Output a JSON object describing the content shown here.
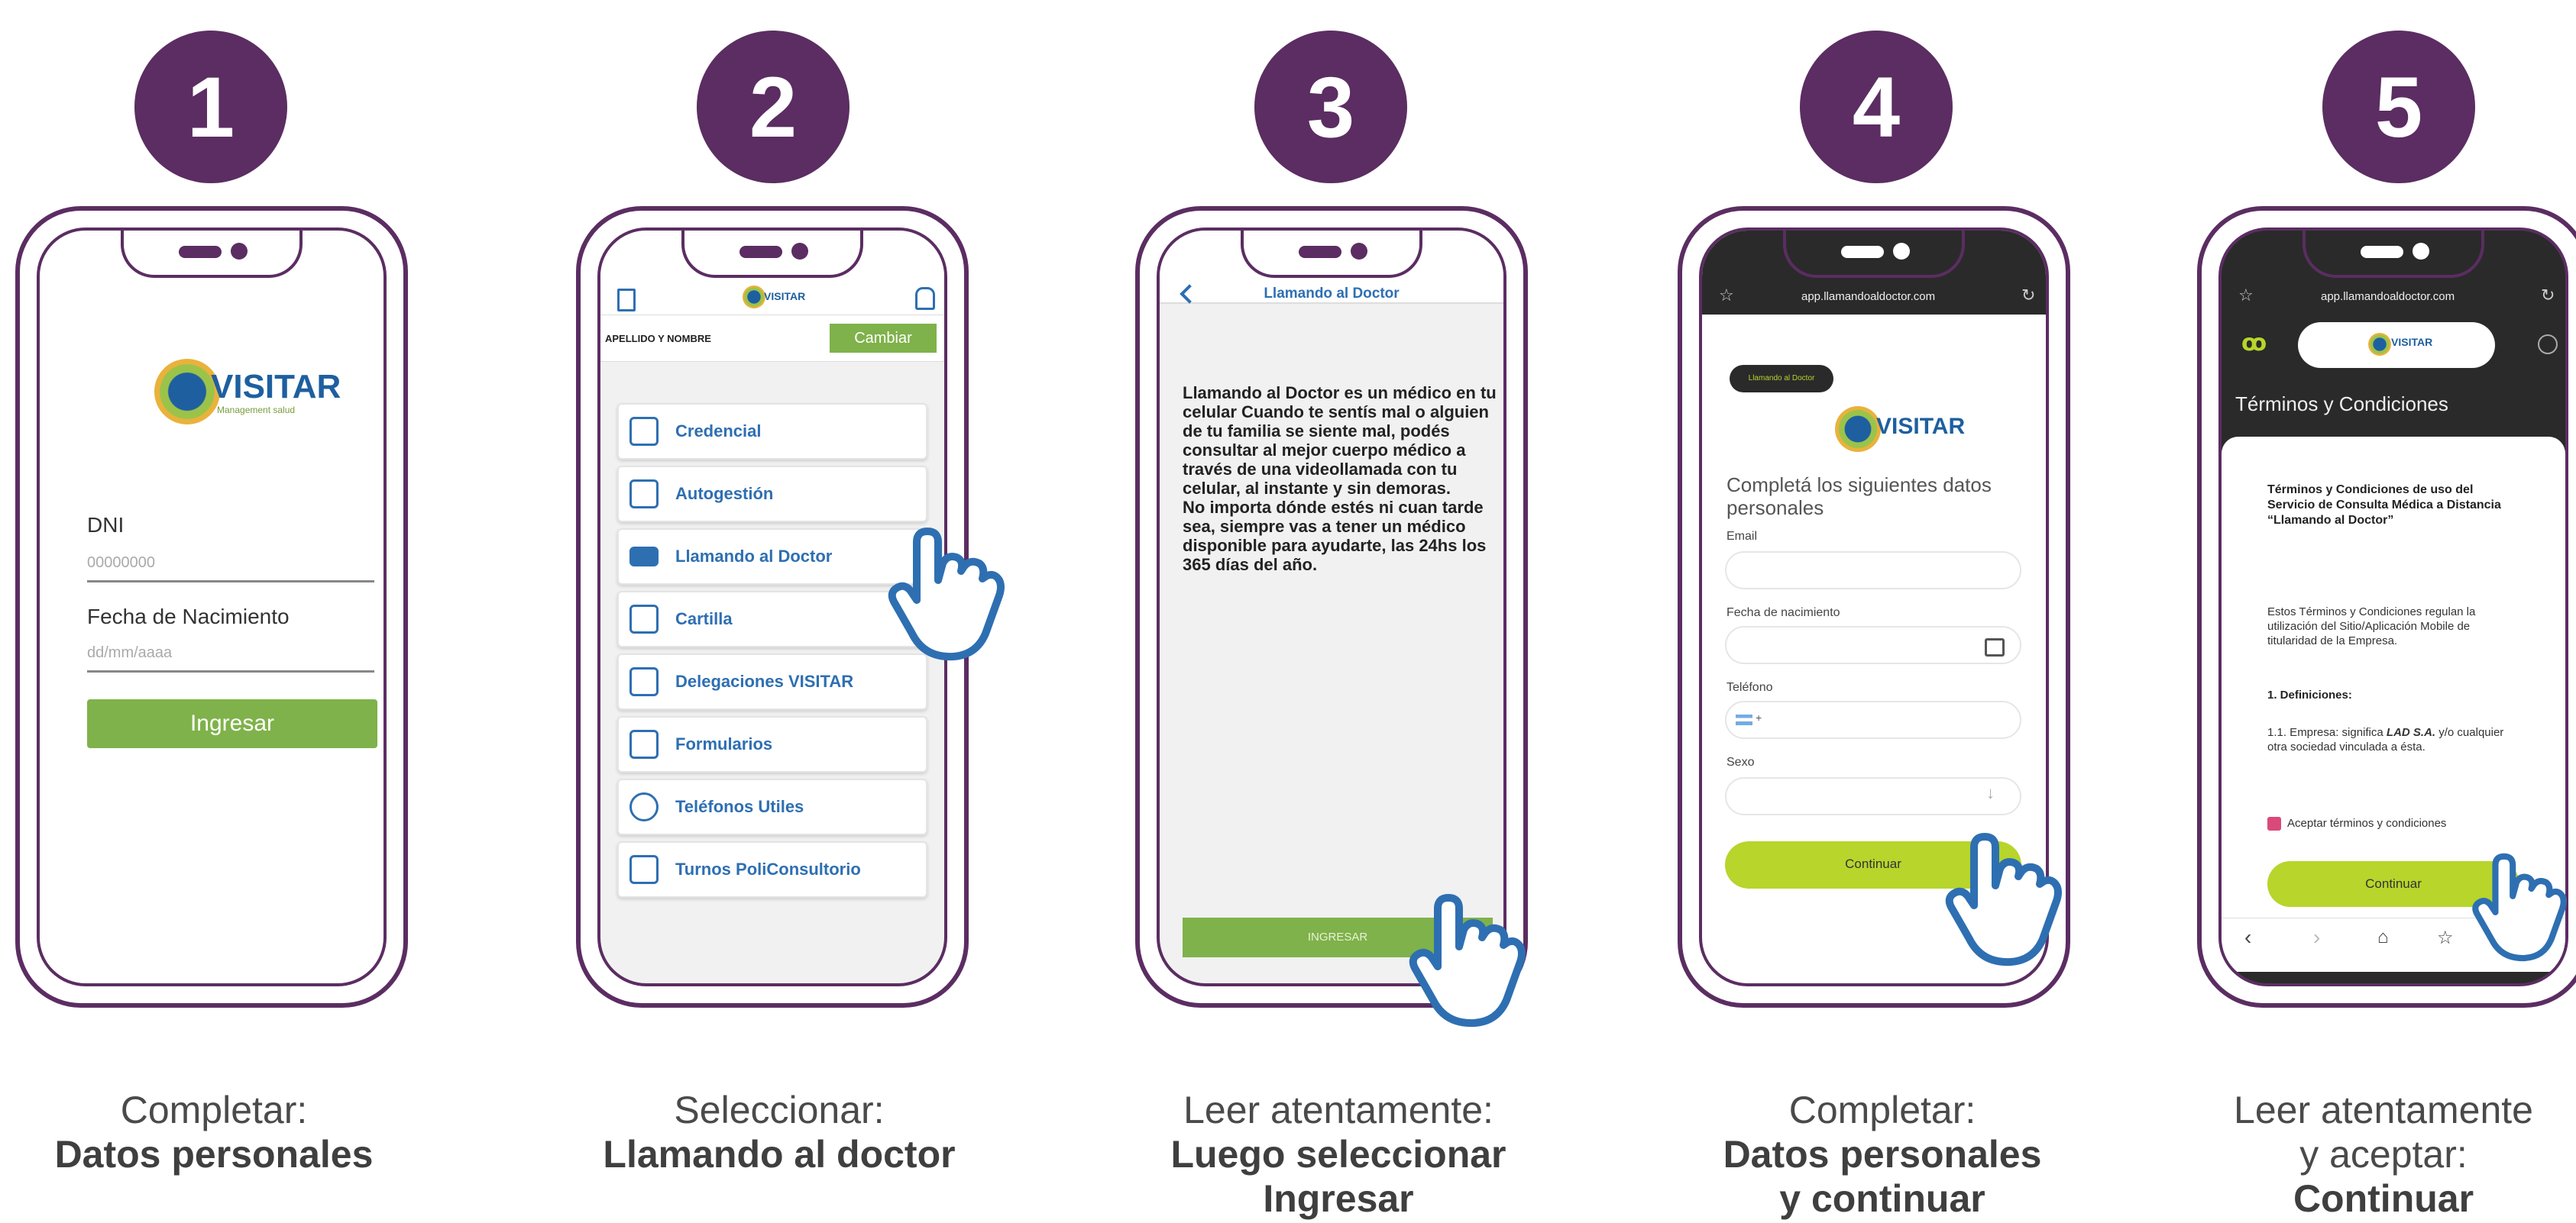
{
  "colors": {
    "purple": "#5b2d62",
    "green": "#7fb24a",
    "lime": "#b7d52b",
    "blue": "#2e6fb2"
  },
  "steps": [
    {
      "number": "1",
      "caption_line1": "Completar:",
      "caption_bold1": "Datos personales",
      "screen": {
        "logo": "VISITAR",
        "logo_sub": "Management salud",
        "dni_label": "DNI",
        "dni_placeholder": "00000000",
        "birth_label": "Fecha de Nacimiento",
        "birth_placeholder": "dd/mm/aaaa",
        "submit_label": "Ingresar"
      }
    },
    {
      "number": "2",
      "caption_line1": "Seleccionar:",
      "caption_bold1": "Llamando al doctor",
      "screen": {
        "logo": "VISITAR",
        "name_label": "APELLIDO Y NOMBRE",
        "change_label": "Cambiar",
        "menu": [
          "Credencial",
          "Autogestión",
          "Llamando al Doctor",
          "Cartilla",
          "Delegaciones VISITAR",
          "Formularios",
          "Teléfonos Utiles",
          "Turnos PoliConsultorio"
        ]
      }
    },
    {
      "number": "3",
      "caption_line1": "Leer atentamente:",
      "caption_bold1": "Luego seleccionar",
      "caption_bold2": "Ingresar",
      "screen": {
        "title": "Llamando al Doctor",
        "body": "Llamando al Doctor es un médico en tu celular Cuando te sentís mal o alguien de tu familia se siente mal, podés consultar al mejor cuerpo médico a través de una videollamada con tu celular, al instante y sin demoras.\nNo importa dónde estés ni cuan tarde sea, siempre vas a tener un médico disponible para ayudarte, las 24hs los 365 días del año.",
        "button": "INGRESAR"
      }
    },
    {
      "number": "4",
      "caption_line1": "Completar:",
      "caption_bold1": "Datos personales",
      "caption_bold2": "y continuar",
      "screen": {
        "url": "app.llamandoaldoctor.com",
        "badge": "Llamando al Doctor",
        "logo": "VISITAR",
        "heading": "Completá los siguientes datos personales",
        "email_label": "Email",
        "birth_label": "Fecha de nacimiento",
        "phone_label": "Teléfono",
        "phone_prefix": "+",
        "sex_label": "Sexo",
        "continue_label": "Continuar"
      }
    },
    {
      "number": "5",
      "caption_line1": "Leer atentamente",
      "caption_line2": "y aceptar:",
      "caption_bold1": "Continuar",
      "screen": {
        "url": "app.llamandoaldoctor.com",
        "logo": "VISITAR",
        "header": "Términos y Condiciones",
        "terms_title": "Términos y Condiciones de uso del Servicio de Consulta Médica a Distancia “Llamando al Doctor”",
        "terms_p1": "Estos Términos y Condiciones regulan la utilización del Sitio/Aplicación Mobile de titularidad de la Empresa.",
        "definitions": "1. Definiciones:",
        "def_1_pre": "1.1. Empresa: significa ",
        "def_1_company": "LAD S.A.",
        "def_1_post": " y/o cualquier otra sociedad vinculada a ésta.",
        "accept_label": "Aceptar términos y condiciones",
        "continue_label": "Continuar"
      }
    }
  ]
}
